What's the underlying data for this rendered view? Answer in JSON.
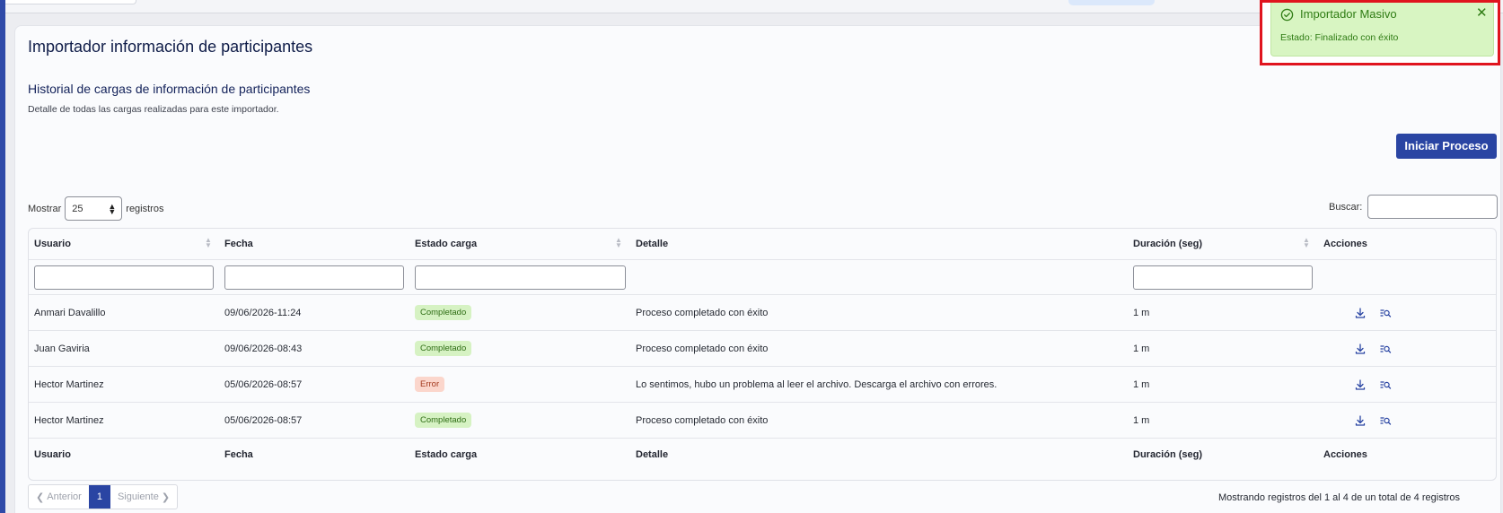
{
  "page": {
    "title": "Importador información de participantes",
    "section_title": "Historial de cargas de información de participantes",
    "section_desc": "Detalle de todas las cargas realizadas para este importador.",
    "start_button": "Iniciar Proceso"
  },
  "table_controls": {
    "show_label": "Mostrar",
    "show_value": "25",
    "records_label": "registros",
    "search_label": "Buscar:",
    "search_value": ""
  },
  "table": {
    "columns": [
      "Usuario",
      "Fecha",
      "Estado carga",
      "Detalle",
      "Duración (seg)",
      "Acciones"
    ],
    "rows": [
      {
        "usuario": "Anmari Davalillo",
        "fecha": "09/06/2026-11:24",
        "estado": "Completado",
        "estado_type": "success",
        "detalle": "Proceso completado con éxito",
        "duracion": "1 m"
      },
      {
        "usuario": "Juan Gaviria",
        "fecha": "09/06/2026-08:43",
        "estado": "Completado",
        "estado_type": "success",
        "detalle": "Proceso completado con éxito",
        "duracion": "1 m"
      },
      {
        "usuario": "Hector Martinez",
        "fecha": "05/06/2026-08:57",
        "estado": "Error",
        "estado_type": "error",
        "detalle": "Lo sentimos, hubo un problema al leer el archivo. Descarga el archivo con errores.",
        "duracion": "1 m"
      },
      {
        "usuario": "Hector Martinez",
        "fecha": "05/06/2026-08:57",
        "estado": "Completado",
        "estado_type": "success",
        "detalle": "Proceso completado con éxito",
        "duracion": "1 m"
      }
    ],
    "row_actions": [
      "download-icon",
      "view-details-icon"
    ]
  },
  "pagination": {
    "prev": "Anterior",
    "current": "1",
    "next": "Siguiente",
    "info": "Mostrando registros del 1 al 4 de un total de 4 registros"
  },
  "toast": {
    "title": "Importador Masivo",
    "message": "Estado: Finalizado con éxito",
    "icon": "check-circle-icon",
    "close_icon": "close-icon"
  },
  "colors": {
    "primary": "#2a45a3",
    "success_bg": "#d6f2c3",
    "success_text": "#2e6d14",
    "error_bg": "#fbd6cc",
    "error_text": "#a33a1f",
    "toast_bg": "#d8f5c2",
    "toast_border": "#e0141e"
  }
}
